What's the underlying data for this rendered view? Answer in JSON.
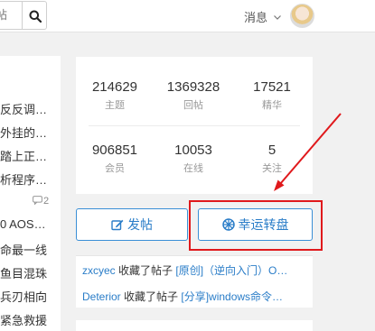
{
  "header": {
    "search_placeholder": "帖",
    "messages_label": "消息"
  },
  "left_posts": [
    "反反调…",
    "外挂的…",
    "踏上正…",
    "析程序…",
    "0 AOS…",
    "命最一线",
    "鱼目混珠",
    "兵刃相向",
    "紧急救援"
  ],
  "left_reply_count": "2",
  "stats": [
    {
      "value": "214629",
      "label": "主题"
    },
    {
      "value": "1369328",
      "label": "回帖"
    },
    {
      "value": "17521",
      "label": "精华"
    },
    {
      "value": "906851",
      "label": "会员"
    },
    {
      "value": "10053",
      "label": "在线"
    },
    {
      "value": "5",
      "label": "关注"
    }
  ],
  "actions": {
    "post_label": "发帖",
    "wheel_label": "幸运转盘"
  },
  "activity": [
    {
      "user": "zxcyec",
      "action": " 收藏了帖子 ",
      "target": "[原创]（逆向入门）O…"
    },
    {
      "user": "Deterior",
      "action": " 收藏了帖子 ",
      "target": "[分享]windows命令…"
    }
  ],
  "colors": {
    "accent": "#2a7dc8",
    "highlight": "#e0191c"
  }
}
